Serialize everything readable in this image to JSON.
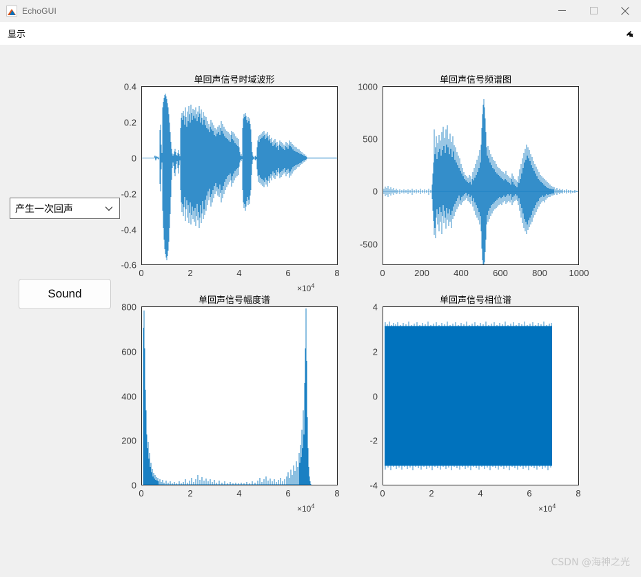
{
  "window": {
    "title": "EchoGUI",
    "icon": "matlab-icon",
    "controls": {
      "minimize": "minimize-icon",
      "maximize": "maximize-icon",
      "close": "close-icon"
    }
  },
  "menubar": {
    "items": [
      {
        "label": "显示"
      }
    ],
    "overflow_icon": "expand-arrow-icon"
  },
  "controls": {
    "mode_select": {
      "value": "产生一次回声",
      "arrow_icon": "chevron-down-icon"
    },
    "sound_button": "Sound"
  },
  "watermark": "CSDN @海神之光",
  "chart_data": [
    {
      "id": "time-domain",
      "type": "line",
      "title": "单回声信号时域波形",
      "xlabel": "",
      "ylabel": "",
      "xlim": [
        0,
        80000
      ],
      "ylim": [
        -0.6,
        0.4
      ],
      "xticks": [
        0,
        2,
        4,
        6,
        8
      ],
      "xtick_labels": [
        "0",
        "2",
        "4",
        "6",
        "8"
      ],
      "x_exponent": "×10",
      "x_exponent_sup": "4",
      "yticks": [
        0.4,
        0.2,
        0,
        -0.2,
        -0.4,
        -0.6
      ],
      "ytick_labels": [
        "0.4",
        "0.2",
        "0",
        "-0.2",
        "-0.4",
        "-0.6"
      ],
      "grid": false,
      "legend": "none",
      "series_color": "#0072BD",
      "description": "Speech waveform with echo: strong burst near 1e4 reaching -0.5 to +0.38, sustained activity 1.3e4 to 3.2e4, isolated burst at 3.6e4, decaying tail 4.2e4 to 6.4e4, flat afterwards."
    },
    {
      "id": "spectrum",
      "type": "line",
      "title": "单回声信号频谱图",
      "xlabel": "",
      "ylabel": "",
      "xlim": [
        0,
        1000
      ],
      "ylim": [
        -700,
        1000
      ],
      "xticks": [
        0,
        200,
        400,
        600,
        800,
        1000
      ],
      "xtick_labels": [
        "0",
        "200",
        "400",
        "600",
        "800",
        "1000"
      ],
      "yticks": [
        1000,
        500,
        0,
        -500
      ],
      "ytick_labels": [
        "1000",
        "500",
        "0",
        "-500"
      ],
      "grid": false,
      "legend": "none",
      "series_color": "#0072BD",
      "description": "Near-zero until ~270, then oscillating bursts peaking ~±400 from 280-430, dominant spike near 560 reaching +690 / -700, moderate oscillation 600-900, tapering to flat by 1000."
    },
    {
      "id": "magnitude-spectrum",
      "type": "line",
      "title": "单回声信号幅度谱",
      "xlabel": "",
      "ylabel": "",
      "xlim": [
        0,
        80000
      ],
      "ylim": [
        0,
        800
      ],
      "xticks": [
        0,
        2,
        4,
        6,
        8
      ],
      "xtick_labels": [
        "0",
        "2",
        "4",
        "6",
        "8"
      ],
      "x_exponent": "×10",
      "x_exponent_sup": "4",
      "yticks": [
        800,
        600,
        400,
        200,
        0
      ],
      "ytick_labels": [
        "800",
        "600",
        "400",
        "200",
        "0"
      ],
      "grid": false,
      "legend": "none",
      "series_color": "#0072BD",
      "description": "Symmetric FFT magnitude: tall narrow peak ~760 at x≈0, rapid decay to a low floor under 40 across the middle, mirrored peak ~770 at x≈6.8e4, nothing plotted beyond 6.85e4."
    },
    {
      "id": "phase-spectrum",
      "type": "line",
      "title": "单回声信号相位谱",
      "xlabel": "",
      "ylabel": "",
      "xlim": [
        0,
        80000
      ],
      "ylim": [
        -4,
        4
      ],
      "xticks": [
        0,
        2,
        4,
        6,
        8
      ],
      "xtick_labels": [
        "0",
        "2",
        "4",
        "6",
        "8"
      ],
      "x_exponent": "×10",
      "x_exponent_sup": "4",
      "yticks": [
        4,
        2,
        0,
        -2,
        -4
      ],
      "ytick_labels": [
        "4",
        "2",
        "0",
        "-2",
        "-4"
      ],
      "grid": false,
      "legend": "none",
      "series_color": "#0072BD",
      "description": "Dense wrapped phase filling the band between -π and +π (≈ -3.14 to 3.14) uniformly from x=0 to x≈6.85e4, blank beyond."
    }
  ]
}
